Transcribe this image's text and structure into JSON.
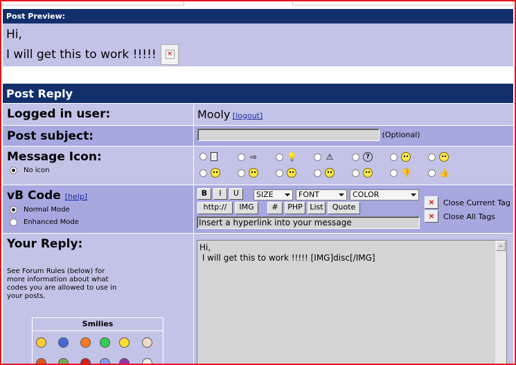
{
  "preview": {
    "header": "Post Preview:",
    "line1": "Hi,",
    "line2": "I will get this to work !!!!!"
  },
  "post_reply": {
    "title": "Post Reply",
    "logged_in_label": "Logged in user:",
    "username": "Mooly",
    "logout_link": "[logout]",
    "subject_label": "Post subject:",
    "subject_value": "",
    "optional": "(Optional)",
    "message_icon_label": "Message Icon:",
    "no_icon": "No icon",
    "vbcode_label": "vB Code",
    "help_link": "[help]",
    "normal_mode": "Normal Mode",
    "enhanced_mode": "Enhanced Mode",
    "reply_label": "Your Reply:",
    "rules_text": "See Forum Rules (below) for more information about what codes you are allowed to use in your posts.",
    "reply_text_line1": "Hi,",
    "reply_text_line2": " I will get this to work !!!!! [IMG]disc[/IMG]"
  },
  "toolbar": {
    "bold": "B",
    "italic": "I",
    "underline": "U",
    "size": "SIZE",
    "font": "FONT",
    "color": "COLOR",
    "http": "http://",
    "img": "IMG",
    "hash": "#",
    "php": "PHP",
    "list": "List",
    "quote": "Quote",
    "status": "Insert a hyperlink into your message",
    "close_current": "Close Current Tag",
    "close_all": "Close All Tags",
    "x": "×"
  },
  "smilies": {
    "title": "Smilies"
  },
  "icons": [
    "document-icon",
    "arrow-right-icon",
    "lightbulb-icon",
    "warning-icon",
    "question-icon",
    "cool-smile-icon",
    "smile-icon",
    "angry-icon",
    "frown-icon",
    "grin-icon",
    "surprised-icon",
    "wink-icon",
    "thumbs-down-icon",
    "thumbs-up-icon"
  ],
  "colors": {
    "header_bg": "#13306d",
    "row_light": "#c3c3e8",
    "row_dark": "#a8a8e0",
    "frame_border": "#e8141a"
  }
}
